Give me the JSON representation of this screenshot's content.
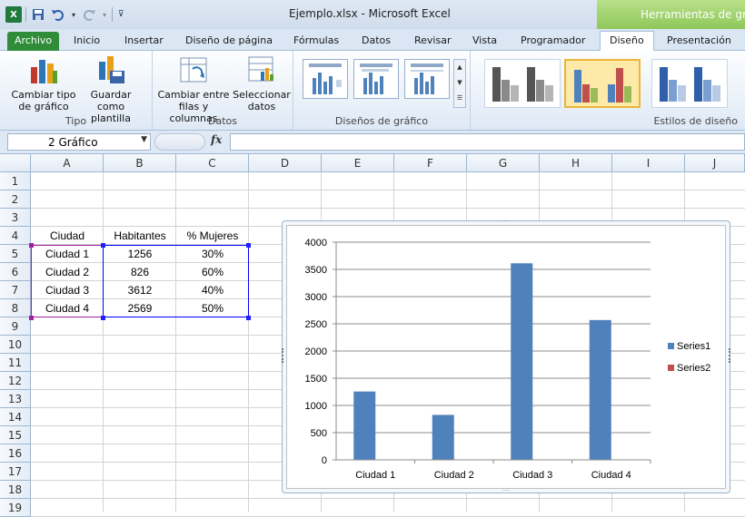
{
  "window": {
    "title": "Ejemplo.xlsx - Microsoft Excel",
    "context_tab": "Herramientas de gráficos"
  },
  "tabs": [
    "Archivo",
    "Inicio",
    "Insertar",
    "Diseño de página",
    "Fórmulas",
    "Datos",
    "Revisar",
    "Vista",
    "Programador",
    "Diseño",
    "Presentación"
  ],
  "active_tab": "Diseño",
  "ribbon": {
    "groups": {
      "tipo": "Tipo",
      "datos": "Datos",
      "disenos": "Diseños de gráfico",
      "estilos": "Estilos de diseño"
    },
    "buttons": {
      "cambiar_tipo": [
        "Cambiar tipo",
        "de gráfico"
      ],
      "guardar_plantilla": [
        "Guardar como",
        "plantilla"
      ],
      "cambiar_filas": [
        "Cambiar entre",
        "filas y columnas"
      ],
      "seleccionar_datos": [
        "Seleccionar",
        "datos"
      ]
    }
  },
  "formula_bar": {
    "name_box": "2 Gráfico",
    "fx": "fx",
    "formula": ""
  },
  "columns": [
    "A",
    "B",
    "C",
    "D",
    "E",
    "F",
    "G",
    "H",
    "I",
    "J"
  ],
  "rows": [
    "1",
    "2",
    "3",
    "4",
    "5",
    "6",
    "7",
    "8",
    "9",
    "10",
    "11",
    "12",
    "13",
    "14",
    "15",
    "16",
    "17",
    "18",
    "19"
  ],
  "table": {
    "headers": [
      "Ciudad",
      "Habitantes",
      "% Mujeres"
    ],
    "rows": [
      [
        "Ciudad 1",
        "1256",
        "30%"
      ],
      [
        "Ciudad 2",
        "826",
        "60%"
      ],
      [
        "Ciudad 3",
        "3612",
        "40%"
      ],
      [
        "Ciudad 4",
        "2569",
        "50%"
      ]
    ]
  },
  "chart_data": {
    "type": "bar",
    "categories": [
      "Ciudad 1",
      "Ciudad 2",
      "Ciudad 3",
      "Ciudad 4"
    ],
    "series": [
      {
        "name": "Series1",
        "values": [
          1256,
          826,
          3612,
          2569
        ],
        "color": "#4f81bd"
      },
      {
        "name": "Series2",
        "values": [
          0.3,
          0.6,
          0.4,
          0.5
        ],
        "color": "#c0504d"
      }
    ],
    "title": "",
    "xlabel": "",
    "ylabel": "",
    "ylim": [
      0,
      4000
    ],
    "yticks": [
      "0",
      "500",
      "1000",
      "1500",
      "2000",
      "2500",
      "3000",
      "3500",
      "4000"
    ],
    "grid": true,
    "legend": "right"
  },
  "colors": {
    "file_tab": "#2f8d3a",
    "context_tab": "#8fc75a",
    "selection_style": "#e9b53a"
  }
}
